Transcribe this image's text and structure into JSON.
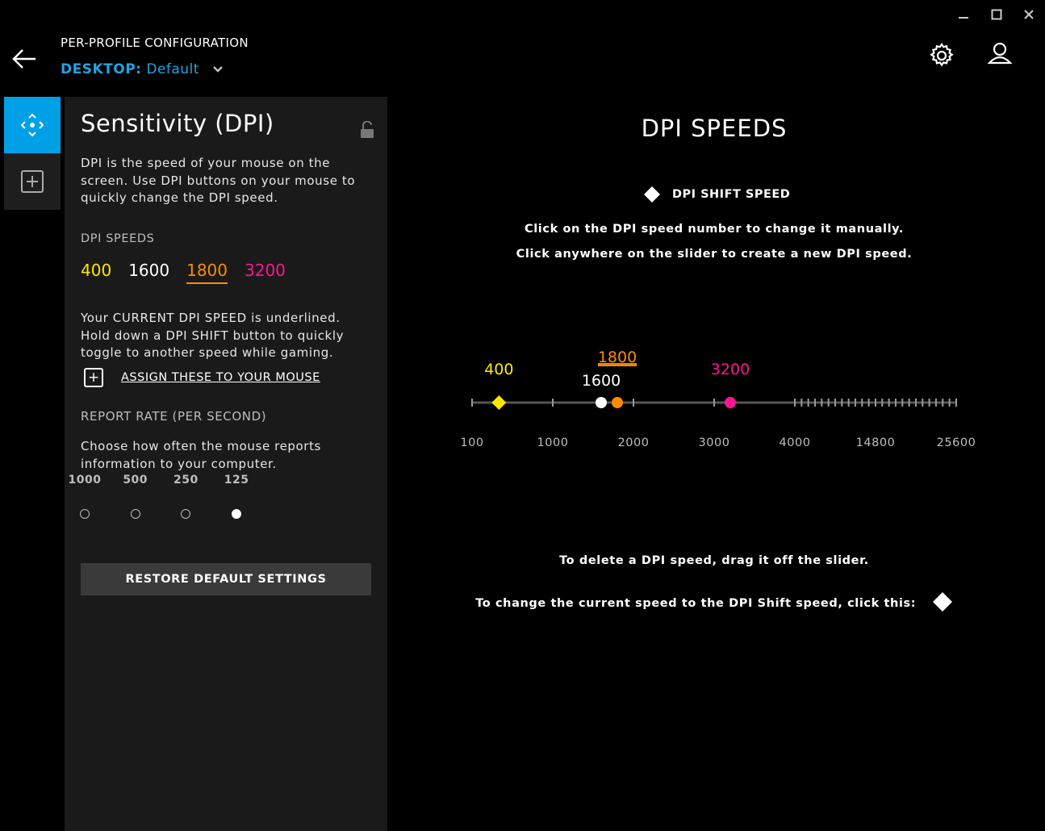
{
  "window": {
    "minimize_icon": "minimize-icon",
    "maximize_icon": "maximize-icon",
    "close_icon": "close-icon"
  },
  "header": {
    "title": "PER-PROFILE CONFIGURATION",
    "profile_label": "DESKTOP:",
    "profile_value": "Default",
    "accent_color": "#1fa3e0"
  },
  "panel": {
    "title": "Sensitivity (DPI)",
    "intro": "DPI is the speed of your mouse on the screen. Use DPI buttons on your mouse to quickly change the DPI speed.",
    "dpi_speeds_heading": "DPI SPEEDS",
    "dpi_speeds": [
      {
        "value": "400",
        "color": "#ffe600",
        "current": false
      },
      {
        "value": "1600",
        "color": "#ffffff",
        "current": false
      },
      {
        "value": "1800",
        "color": "#ff8c00",
        "current": true
      },
      {
        "value": "3200",
        "color": "#ff1493",
        "current": false
      }
    ],
    "current_note": "Your CURRENT DPI SPEED is underlined. Hold down a DPI SHIFT button to quickly toggle to another speed while gaming.",
    "assign_label": "ASSIGN THESE TO YOUR MOUSE",
    "report_rate_heading": "REPORT RATE (PER SECOND)",
    "report_rate_desc": "Choose how often the mouse reports information to your computer.",
    "report_rates": [
      {
        "label": "1000",
        "selected": false
      },
      {
        "label": "500",
        "selected": false
      },
      {
        "label": "250",
        "selected": false
      },
      {
        "label": "125",
        "selected": true
      }
    ],
    "restore_label": "RESTORE DEFAULT SETTINGS"
  },
  "main": {
    "title": "DPI SPEEDS",
    "legend_label": "DPI SHIFT SPEED",
    "instruction_1": "Click on the DPI speed number to change it manually.",
    "instruction_2": "Click anywhere on the slider to create a new DPI speed.",
    "delete_note": "To delete a DPI speed, drag it off the slider.",
    "shift_note": "To change the current speed to the DPI Shift speed, click this:"
  },
  "slider": {
    "scale_labels": [
      "100",
      "1000",
      "2000",
      "3000",
      "4000",
      "14800",
      "25600"
    ],
    "markers": [
      {
        "value": "400",
        "color": "#ffe600",
        "shape": "diamond",
        "current": false,
        "shift": true
      },
      {
        "value": "1600",
        "color": "#ffffff",
        "shape": "dot",
        "current": false,
        "shift": false
      },
      {
        "value": "1800",
        "color": "#ff8c00",
        "shape": "dot",
        "current": true,
        "shift": false
      },
      {
        "value": "3200",
        "color": "#ff1493",
        "shape": "dot",
        "current": false,
        "shift": false
      }
    ]
  }
}
